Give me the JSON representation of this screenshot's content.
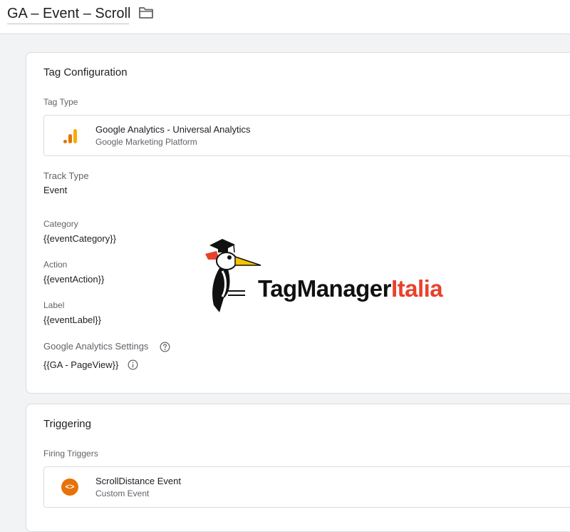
{
  "header": {
    "tag_name": "GA – Event – Scroll",
    "folder_icon": "folder-icon"
  },
  "config": {
    "title": "Tag Configuration",
    "tag_type_label": "Tag Type",
    "tag_type": {
      "name": "Google Analytics - Universal Analytics",
      "platform": "Google Marketing Platform",
      "icon": "google-analytics-icon",
      "icon_colors": [
        "#f9ab00",
        "#e37400"
      ]
    },
    "track_type_label": "Track Type",
    "track_type_value": "Event",
    "fields": [
      {
        "label": "Category",
        "value": "{{eventCategory}}"
      },
      {
        "label": "Action",
        "value": "{{eventAction}}"
      },
      {
        "label": "Label",
        "value": "{{eventLabel}}"
      }
    ],
    "ga_settings_label": "Google Analytics Settings",
    "ga_settings_value": "{{GA - PageView}}",
    "help_icon": "help-circle-icon",
    "info_icon": "info-icon"
  },
  "triggering": {
    "title": "Triggering",
    "firing_label": "Firing Triggers",
    "trigger": {
      "name": "ScrollDistance Event",
      "type": "Custom Event",
      "icon": "custom-event-icon",
      "icon_color": "#e8710a"
    }
  },
  "watermark": {
    "text_part1": "TagManager",
    "text_part2": "Italia",
    "accent_color": "#e8412c",
    "icon": "woodpecker-mascot-icon"
  }
}
